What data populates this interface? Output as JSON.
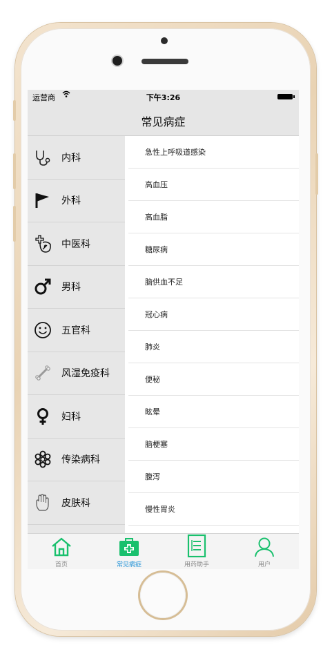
{
  "status": {
    "carrier": "运营商",
    "time": "下午3:26"
  },
  "nav": {
    "title": "常见病症"
  },
  "categories": [
    {
      "label": "内科",
      "icon": "stethoscope-icon"
    },
    {
      "label": "外科",
      "icon": "flag-icon"
    },
    {
      "label": "中医科",
      "icon": "herbal-medicine-icon"
    },
    {
      "label": "男科",
      "icon": "male-symbol-icon"
    },
    {
      "label": "五官科",
      "icon": "smiley-face-icon"
    },
    {
      "label": "风湿免疫科",
      "icon": "bone-icon"
    },
    {
      "label": "妇科",
      "icon": "female-symbol-icon"
    },
    {
      "label": "传染病科",
      "icon": "virus-icon"
    },
    {
      "label": "皮肤科",
      "icon": "hand-icon"
    }
  ],
  "diseases": [
    "急性上呼吸道感染",
    "高血压",
    "高血脂",
    "糖尿病",
    "脑供血不足",
    "冠心病",
    "肺炎",
    "便秘",
    "眩晕",
    "脑梗塞",
    "腹泻",
    "慢性胃炎"
  ],
  "tabs": [
    {
      "label": "首页",
      "icon": "home-icon"
    },
    {
      "label": "常见病症",
      "icon": "medical-kit-icon"
    },
    {
      "label": "用药助手",
      "icon": "document-icon"
    },
    {
      "label": "用户",
      "icon": "user-icon"
    }
  ],
  "colors": {
    "accent_green": "#19c06d",
    "active_tab_text": "#1b8fd6"
  }
}
